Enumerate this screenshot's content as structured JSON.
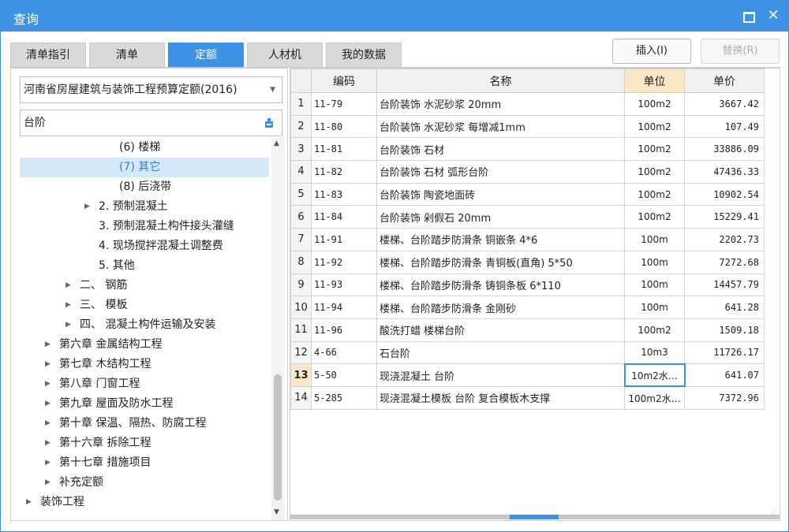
{
  "window": {
    "title": "查询"
  },
  "tabs": [
    "清单指引",
    "清单",
    "定额",
    "人材机",
    "我的数据"
  ],
  "active_tab": 2,
  "buttons": {
    "insert": "插入(I)",
    "replace": "替换(R)"
  },
  "left": {
    "quota_library": "河南省房屋建筑与装饰工程预算定额(2016)",
    "search_value": "台阶",
    "tree": [
      {
        "label": "(6) 楼梯",
        "arrow": "",
        "indent": 2
      },
      {
        "label": "(7) 其它",
        "arrow": "",
        "indent": 2,
        "selected": true
      },
      {
        "label": "(8) 后浇带",
        "arrow": "",
        "indent": 2
      },
      {
        "label": "2. 预制混凝土",
        "arrow": "▶",
        "indent": 1
      },
      {
        "label": "3. 预制混凝土构件接头灌缝",
        "arrow": "",
        "indent": 1
      },
      {
        "label": "4. 现场搅拌混凝土调整费",
        "arrow": "",
        "indent": 1
      },
      {
        "label": "5. 其他",
        "arrow": "",
        "indent": 1
      },
      {
        "label": "二、 钢筋",
        "arrow": "▶",
        "indent": 0
      },
      {
        "label": "三、 模板",
        "arrow": "▶",
        "indent": 0
      },
      {
        "label": "四、 混凝土构件运输及安装",
        "arrow": "▶",
        "indent": 0
      },
      {
        "label": "第六章 金属结构工程",
        "arrow": "▶",
        "indent": -1
      },
      {
        "label": "第七章 木结构工程",
        "arrow": "▶",
        "indent": -1
      },
      {
        "label": "第八章 门窗工程",
        "arrow": "▶",
        "indent": -1
      },
      {
        "label": "第九章 屋面及防水工程",
        "arrow": "▶",
        "indent": -1
      },
      {
        "label": "第十章 保温、隔热、防腐工程",
        "arrow": "▶",
        "indent": -1
      },
      {
        "label": "第十六章 拆除工程",
        "arrow": "▶",
        "indent": -1
      },
      {
        "label": "第十七章 措施项目",
        "arrow": "▶",
        "indent": -1
      },
      {
        "label": "补充定额",
        "arrow": "▶",
        "indent": -1
      },
      {
        "label": "装饰工程",
        "arrow": "▶",
        "indent": -2
      }
    ]
  },
  "grid": {
    "columns": [
      "编码",
      "名称",
      "单位",
      "单价"
    ],
    "current_row": 13,
    "rows": [
      {
        "n": "1",
        "code": "11-79",
        "name": "台阶装饰 水泥砂浆 20mm",
        "unit": "100m2",
        "price": "3667.42"
      },
      {
        "n": "2",
        "code": "11-80",
        "name": "台阶装饰 水泥砂浆 每增减1mm",
        "unit": "100m2",
        "price": "107.49"
      },
      {
        "n": "3",
        "code": "11-81",
        "name": "台阶装饰 石材",
        "unit": "100m2",
        "price": "33886.09"
      },
      {
        "n": "4",
        "code": "11-82",
        "name": "台阶装饰 石材 弧形台阶",
        "unit": "100m2",
        "price": "47436.33"
      },
      {
        "n": "5",
        "code": "11-83",
        "name": "台阶装饰 陶瓷地面砖",
        "unit": "100m2",
        "price": "10902.54"
      },
      {
        "n": "6",
        "code": "11-84",
        "name": "台阶装饰 剁假石 20mm",
        "unit": "100m2",
        "price": "15229.41"
      },
      {
        "n": "7",
        "code": "11-91",
        "name": "楼梯、台阶踏步防滑条 铜嵌条 4*6",
        "unit": "100m",
        "price": "2202.73"
      },
      {
        "n": "8",
        "code": "11-92",
        "name": "楼梯、台阶踏步防滑条 青铜板(直角) 5*50",
        "unit": "100m",
        "price": "7272.68"
      },
      {
        "n": "9",
        "code": "11-93",
        "name": "楼梯、台阶踏步防滑条 铸铜条板 6*110",
        "unit": "100m",
        "price": "14457.79"
      },
      {
        "n": "10",
        "code": "11-94",
        "name": "楼梯、台阶踏步防滑条 金刚砂",
        "unit": "100m",
        "price": "641.28"
      },
      {
        "n": "11",
        "code": "11-96",
        "name": "酸洗打蜡 楼梯台阶",
        "unit": "100m2",
        "price": "1509.18"
      },
      {
        "n": "12",
        "code": "4-66",
        "name": "石台阶",
        "unit": "10m3",
        "price": "11726.17"
      },
      {
        "n": "13",
        "code": "5-50",
        "name": "现浇混凝土 台阶",
        "unit": "10m2水…",
        "price": "641.07"
      },
      {
        "n": "14",
        "code": "5-285",
        "name": "现浇混凝土模板 台阶 复合模板木支撑",
        "unit": "100m2水…",
        "price": "7372.96"
      }
    ]
  }
}
